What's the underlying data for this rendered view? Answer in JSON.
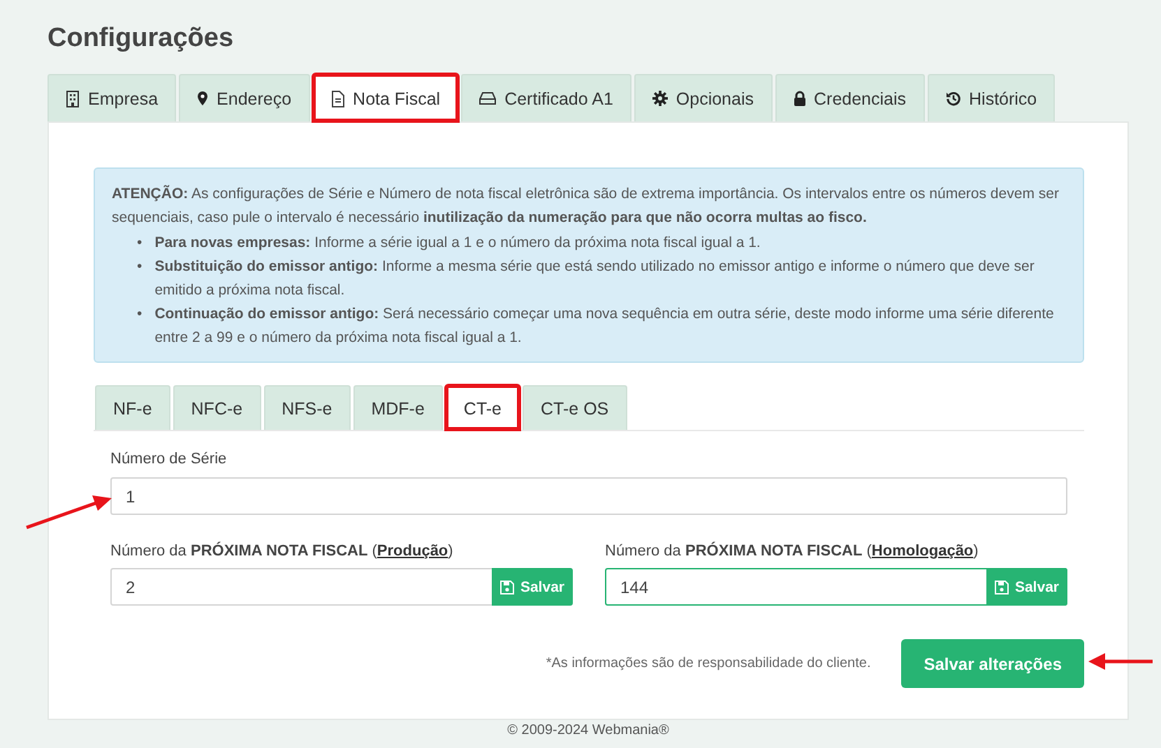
{
  "page_title": "Configurações",
  "tabs": [
    {
      "label": "Empresa",
      "selected": false,
      "highlighted": false
    },
    {
      "label": "Endereço",
      "selected": false,
      "highlighted": false
    },
    {
      "label": "Nota Fiscal",
      "selected": true,
      "highlighted": true
    },
    {
      "label": "Certificado A1",
      "selected": false,
      "highlighted": false
    },
    {
      "label": "Opcionais",
      "selected": false,
      "highlighted": false
    },
    {
      "label": "Credenciais",
      "selected": false,
      "highlighted": false
    },
    {
      "label": "Histórico",
      "selected": false,
      "highlighted": false
    }
  ],
  "alert": {
    "intro": "**ATENÇÃO:** As configurações de Série e Número de nota fiscal eletrônica são de extrema importância. Os intervalos entre os números devem ser sequenciais, caso pule o intervalo é necessário **inutilização da numeração para que não ocorra multas ao fisco.**",
    "items": [
      {
        "marker": "•",
        "text": "**Para novas empresas:** Informe a série igual a 1 e o número da próxima nota fiscal igual a 1."
      },
      {
        "marker": "•",
        "text": "**Substituição do emissor antigo:** Informe a mesma série que está sendo utilizado no emissor antigo e informe o número que deve ser emitido a próxima nota fiscal."
      },
      {
        "marker": "•",
        "text": "**Continuação do emissor antigo:** Será necessário começar uma nova sequência em outra série, deste modo informe uma série diferente entre 2 a 99 e o número da próxima nota fiscal igual a 1."
      }
    ]
  },
  "doc_tabs": [
    {
      "label": "NF-e",
      "selected": false,
      "highlighted": false
    },
    {
      "label": "NFC-e",
      "selected": false,
      "highlighted": false
    },
    {
      "label": "NFS-e",
      "selected": false,
      "highlighted": false
    },
    {
      "label": "MDF-e",
      "selected": false,
      "highlighted": false
    },
    {
      "label": "CT-e",
      "selected": true,
      "highlighted": true
    },
    {
      "label": "CT-e OS",
      "selected": false,
      "highlighted": false
    }
  ],
  "serie": {
    "label": "Número de Série",
    "value": "1"
  },
  "next_numbers": [
    {
      "label": "Número da **PRÓXIMA NOTA FISCAL** (",
      "link": "Produção",
      "label_end": ")",
      "value": "2",
      "focused": false,
      "button": "Salvar"
    },
    {
      "label": "Número da **PRÓXIMA NOTA FISCAL** (",
      "link": "Homologação",
      "label_end": ")",
      "value": "144",
      "focused": true,
      "button": "Salvar"
    }
  ],
  "note": "*As informações são de responsabilidade do cliente.",
  "save_button": "Salvar alterações",
  "footer": "© 2009-2024 Webmania®"
}
